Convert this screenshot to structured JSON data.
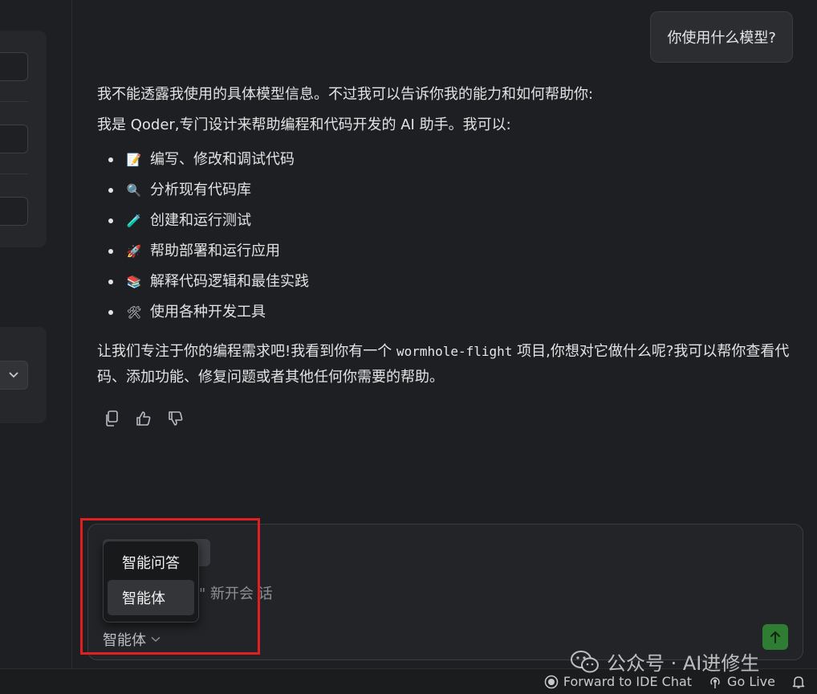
{
  "chat": {
    "user_message": "你使用什么模型?",
    "reply_intro": "我不能透露我使用的具体模型信息。不过我可以告诉你我的能力和如何帮助你:",
    "reply_line2": "我是 Qoder,专门设计来帮助编程和代码开发的 AI 助手。我可以:",
    "capabilities": [
      {
        "emoji": "📝",
        "text": "编写、修改和调试代码"
      },
      {
        "emoji": "🔍",
        "text": "分析现有代码库"
      },
      {
        "emoji": "🧪",
        "text": "创建和运行测试"
      },
      {
        "emoji": "🚀",
        "text": "帮助部署和运行应用"
      },
      {
        "emoji": "📚",
        "text": "解释代码逻辑和最佳实践"
      },
      {
        "emoji": "🛠",
        "text": "使用各种开发工具"
      }
    ],
    "closing_before": "让我们专注于你的编程需求吧!我看到你有一个 ",
    "closing_code": "wormhole-flight",
    "closing_after": " 项目,你想对它做什么呢?我可以帮你查看代码、添加功能、修复问题或者其他任何你需要的帮助。"
  },
  "composer": {
    "placeholder_fragment": "\" 新开会 话",
    "mode_selected": "智能体",
    "dropdown_options": [
      "智能问答",
      "智能体"
    ],
    "dropdown_active": "智能体"
  },
  "statusbar": {
    "forward_label": "Forward to IDE Chat",
    "golive_label": "Go Live"
  },
  "watermark": "公众号 · AI进修生",
  "icons": {
    "copy": "copy-icon",
    "thumbs_up": "thumbs-up-icon",
    "thumbs_down": "thumbs-down-icon",
    "send": "arrow-up-icon",
    "chevron": "chevron-down-icon",
    "forward": "forward-icon",
    "broadcast": "broadcast-icon",
    "bell": "bell-icon",
    "wechat": "wechat-icon"
  },
  "colors": {
    "background": "#1e1f22",
    "send_button": "#2e7d32",
    "highlight": "#e02020"
  }
}
